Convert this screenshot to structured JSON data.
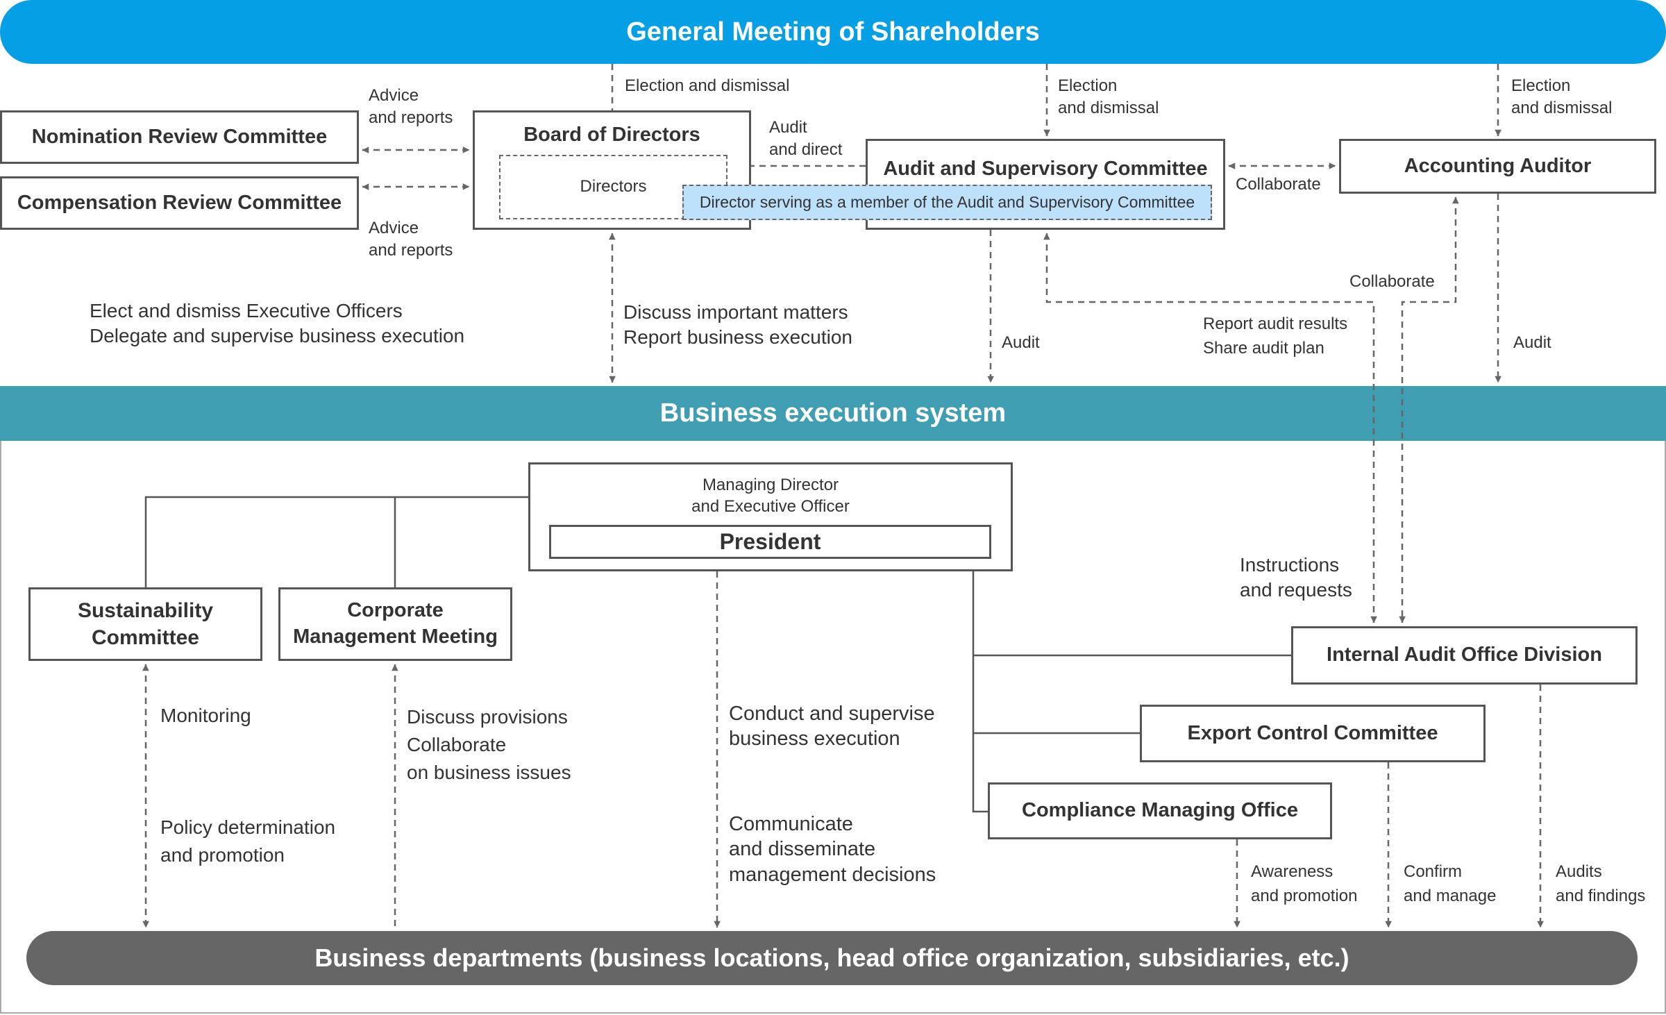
{
  "colors": {
    "shareholders": "#049fe5",
    "business_execution": "#409eb3",
    "business_departments": "#666666",
    "highlight": "#bde0fb",
    "line": "#666666"
  },
  "top": {
    "title": "General Meeting of Shareholders"
  },
  "supervision": {
    "nomination": "Nomination Review Committee",
    "compensation": "Compensation Review Committee",
    "board": "Board of Directors",
    "directors": "Directors",
    "audit_committee": "Audit and Supervisory Committee",
    "audit_committee_member": "Director serving as a member of the Audit and Supervisory Committee",
    "accounting_auditor": "Accounting Auditor"
  },
  "labels": {
    "advice_reports_1": [
      "Advice",
      "and reports"
    ],
    "advice_reports_2": [
      "Advice",
      "and reports"
    ],
    "election_board": "Election and dismissal",
    "election_audit": [
      "Election",
      "and dismissal"
    ],
    "election_accounting": [
      "Election",
      "and dismissal"
    ],
    "audit_direct": [
      "Audit",
      "and direct"
    ],
    "collaborate_1": "Collaborate",
    "elect_dismiss": [
      "Elect and dismiss Executive Officers",
      "Delegate and supervise business execution"
    ],
    "discuss_report": [
      "Discuss important matters",
      "Report business execution"
    ],
    "audit_1": "Audit",
    "collaborate_2": "Collaborate",
    "report_share": [
      "Report audit results",
      "Share audit plan"
    ],
    "audit_2": "Audit",
    "instructions": [
      "Instructions",
      "and requests"
    ],
    "monitoring": "Monitoring",
    "policy": [
      "Policy determination",
      "and promotion"
    ],
    "discuss_provisions": [
      "Discuss provisions",
      "Collaborate",
      "on business issues"
    ],
    "conduct": [
      "Conduct and supervise",
      "business execution"
    ],
    "communicate": [
      "Communicate",
      "and disseminate",
      "management decisions"
    ],
    "awareness": [
      "Awareness",
      "and promotion"
    ],
    "confirm": [
      "Confirm",
      "and manage"
    ],
    "audits_findings": [
      "Audits",
      "and findings"
    ]
  },
  "execution": {
    "band_title": "Business execution system",
    "managing_director": [
      "Managing Director",
      "and Executive Officer"
    ],
    "president": "President",
    "sustainability": [
      "Sustainability",
      "Committee"
    ],
    "corporate_meeting": [
      "Corporate",
      "Management Meeting"
    ],
    "internal_audit": "Internal Audit Office Division",
    "export_control": "Export Control Committee",
    "compliance": "Compliance Managing Office"
  },
  "bottom": {
    "title": "Business departments (business locations, head office organization, subsidiaries, etc.)"
  }
}
